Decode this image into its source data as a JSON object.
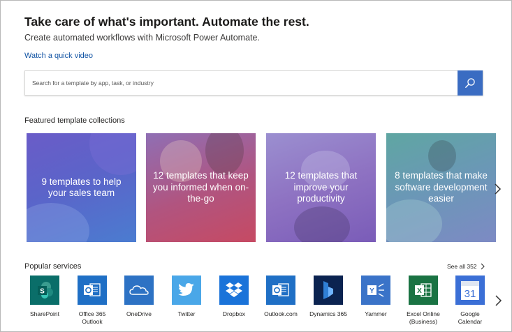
{
  "hero": {
    "title": "Take care of what's important. Automate the rest.",
    "subtitle": "Create automated workflows with Microsoft Power Automate.",
    "video_link": "Watch a quick video"
  },
  "search": {
    "placeholder": "Search for a template by app, task, or industry"
  },
  "featured": {
    "heading": "Featured template collections",
    "cards": [
      {
        "text": "9 templates to help your sales team"
      },
      {
        "text": "12 templates that keep you informed when on-the-go"
      },
      {
        "text": "12 templates that improve your productivity"
      },
      {
        "text": "8 templates that make software development easier"
      }
    ]
  },
  "popular": {
    "heading": "Popular services",
    "see_all": "See all 352",
    "services": [
      {
        "name": "SharePoint",
        "icon": "sharepoint-icon",
        "color": "#0a6e69"
      },
      {
        "name": "Office 365 Outlook",
        "icon": "outlook-icon",
        "color": "#1f6fc5"
      },
      {
        "name": "OneDrive",
        "icon": "onedrive-icon",
        "color": "#2d72c4"
      },
      {
        "name": "Twitter",
        "icon": "twitter-icon",
        "color": "#4aa7e8"
      },
      {
        "name": "Dropbox",
        "icon": "dropbox-icon",
        "color": "#1a73d9"
      },
      {
        "name": "Outlook.com",
        "icon": "outlook-com-icon",
        "color": "#1f6fc5"
      },
      {
        "name": "Dynamics 365",
        "icon": "dynamics-icon",
        "color": "#0b2350"
      },
      {
        "name": "Yammer",
        "icon": "yammer-icon",
        "color": "#3a73c8"
      },
      {
        "name": "Excel Online (Business)",
        "icon": "excel-icon",
        "color": "#1a7343"
      },
      {
        "name": "Google Calendar",
        "icon": "google-calendar-icon",
        "color": "#3b6fd6"
      }
    ]
  },
  "colors": {
    "accent": "#3a6cc2",
    "link": "#0f52a3"
  }
}
